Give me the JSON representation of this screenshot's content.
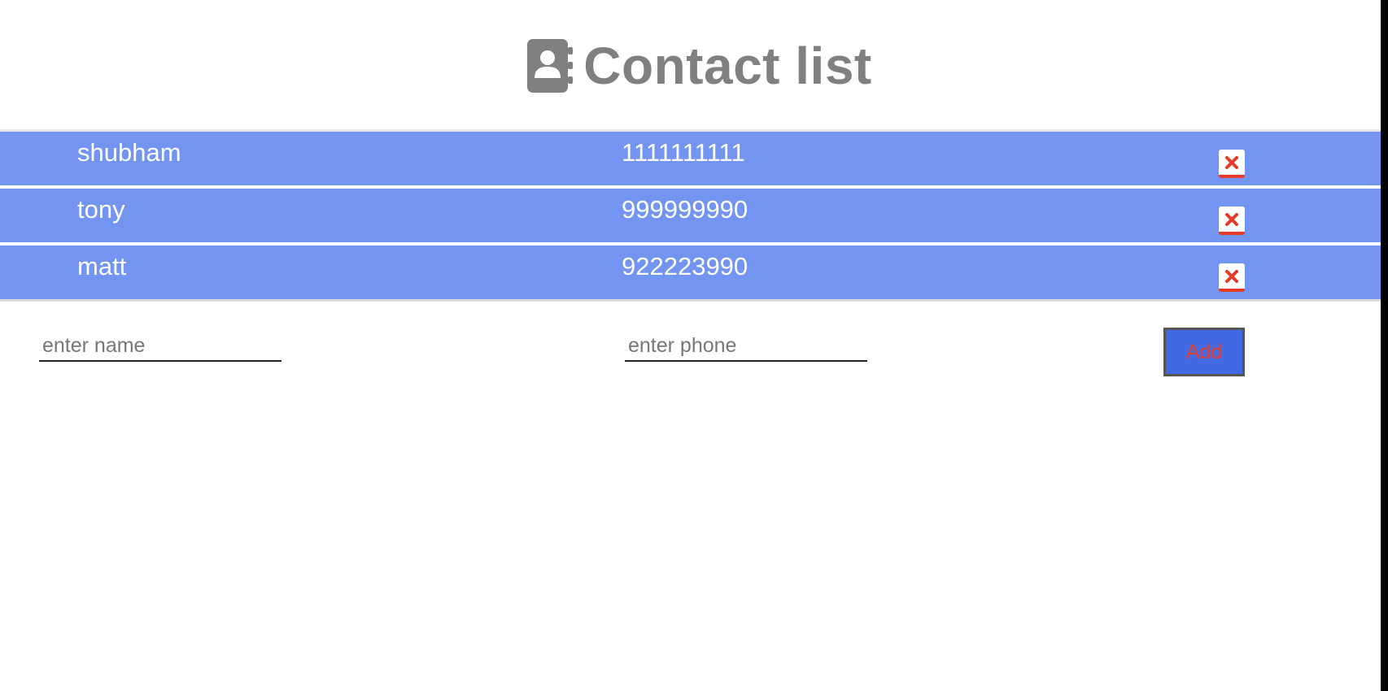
{
  "header": {
    "title": "Contact list",
    "icon": "address-book-icon",
    "icon_color": "#808080"
  },
  "contacts": [
    {
      "name": "shubham",
      "phone": "1111111111",
      "delete_icon": "close-icon"
    },
    {
      "name": "tony",
      "phone": "999999990",
      "delete_icon": "close-icon"
    },
    {
      "name": "matt",
      "phone": "922223990",
      "delete_icon": "close-icon"
    }
  ],
  "form": {
    "name_placeholder": "enter name",
    "phone_placeholder": "enter phone",
    "name_value": "",
    "phone_value": "",
    "add_label": "Add"
  },
  "colors": {
    "row_background": "#7395f1",
    "row_text": "#ffffff",
    "delete_accent": "#e53b28",
    "add_button_background": "#4169e1",
    "add_button_text": "#e53b28"
  }
}
